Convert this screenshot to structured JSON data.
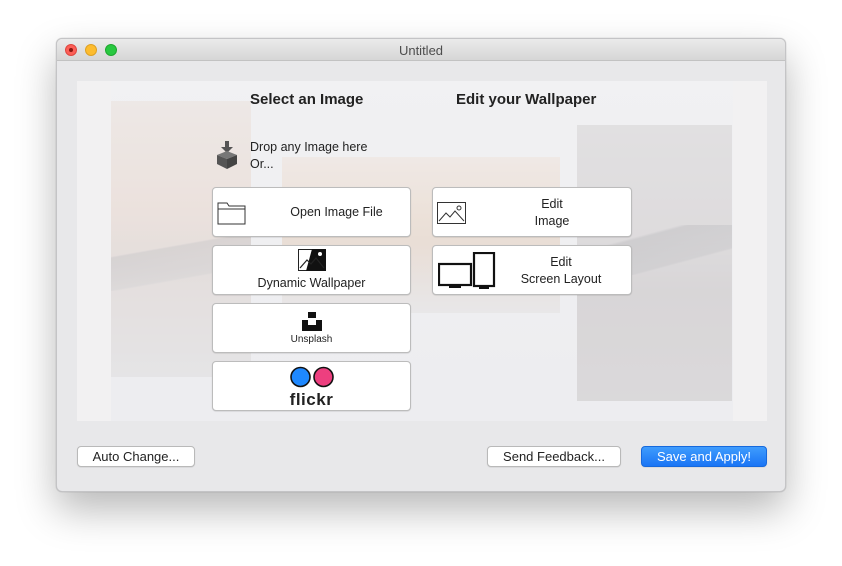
{
  "window": {
    "title": "Untitled"
  },
  "left_column": {
    "heading": "Select an Image",
    "drop_line1": "Drop any Image here",
    "drop_line2": "Or...",
    "open_file_label": "Open Image File",
    "dynamic_label": "Dynamic Wallpaper",
    "unsplash_label": "Unsplash",
    "flickr_label": "flickr"
  },
  "right_column": {
    "heading": "Edit your Wallpaper",
    "edit_image_line1": "Edit",
    "edit_image_line2": "Image",
    "edit_layout_line1": "Edit",
    "edit_layout_line2": "Screen Layout"
  },
  "footer": {
    "auto_change_label": "Auto Change...",
    "feedback_label": "Send Feedback...",
    "save_label": "Save and Apply!"
  },
  "colors": {
    "accent": "#1a75f5",
    "flickr_blue": "#1e88ff",
    "flickr_pink": "#ed3f7f"
  }
}
